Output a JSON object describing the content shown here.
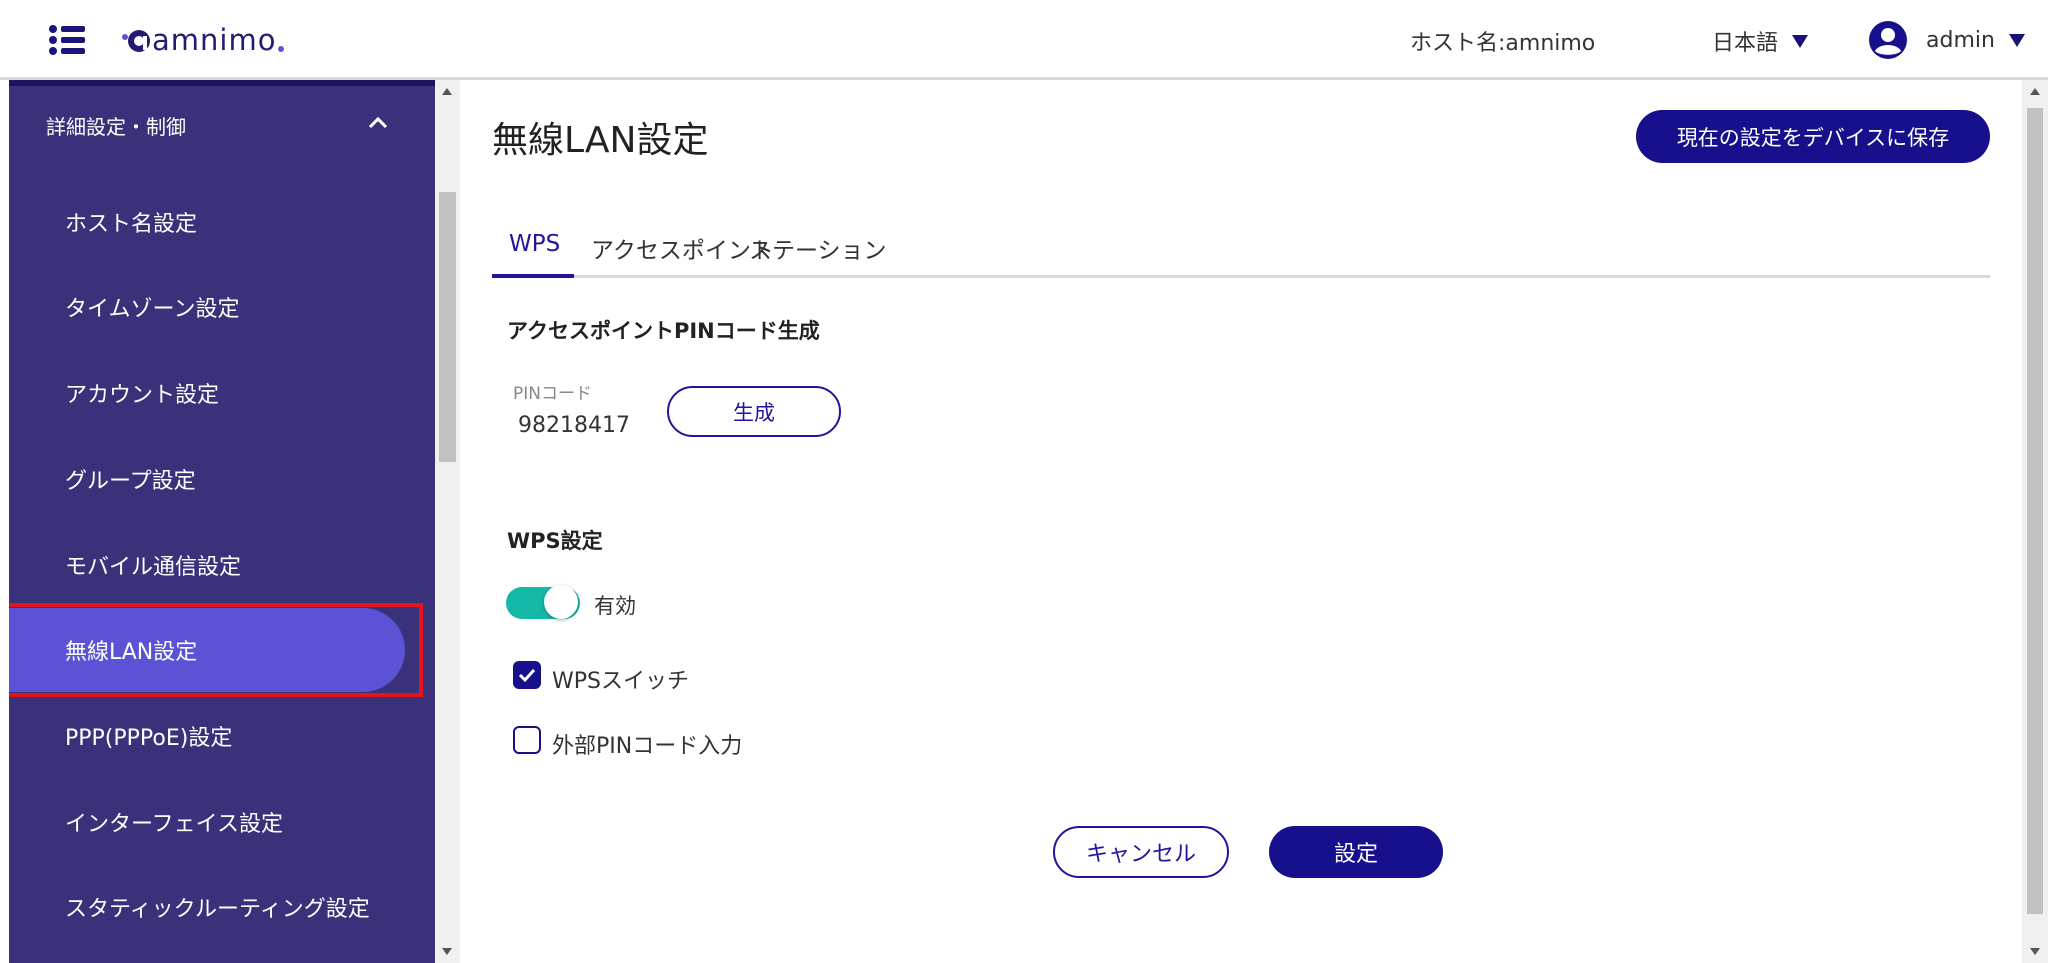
{
  "header": {
    "brand": "amnimo",
    "hostname": "ホスト名:amnimo",
    "language": "日本語",
    "user": "admin"
  },
  "sidebar": {
    "group_label": "詳細設定・制御",
    "items": [
      {
        "label": "ホスト名設定"
      },
      {
        "label": "タイムゾーン設定"
      },
      {
        "label": "アカウント設定"
      },
      {
        "label": "グループ設定"
      },
      {
        "label": "モバイル通信設定"
      },
      {
        "label": "無線LAN設定",
        "active": true
      },
      {
        "label": "PPP(PPPoE)設定"
      },
      {
        "label": "インターフェイス設定"
      },
      {
        "label": "スタティックルーティング設定"
      }
    ]
  },
  "main": {
    "title": "無線LAN設定",
    "save_button": "現在の設定をデバイスに保存",
    "tabs": [
      {
        "label": "WPS",
        "active": true
      },
      {
        "label": "アクセスポイント"
      },
      {
        "label": "ステーション"
      }
    ],
    "pin_section": {
      "title": "アクセスポイントPINコード生成",
      "pin_label": "PINコード",
      "pin_value": "98218417",
      "generate_button": "生成"
    },
    "wps_section": {
      "title": "WPS設定",
      "toggle_label": "有効",
      "toggle_on": true,
      "checkboxes": [
        {
          "label": "WPSスイッチ",
          "checked": true
        },
        {
          "label": "外部PINコード入力",
          "checked": false
        }
      ]
    },
    "cancel_button": "キャンセル",
    "submit_button": "設定"
  },
  "colors": {
    "sidebar_bg": "#39327a",
    "sidebar_active": "#5b52d6",
    "primary": "#17108c",
    "toggle": "#14b8a6",
    "highlight": "#e5141c"
  }
}
